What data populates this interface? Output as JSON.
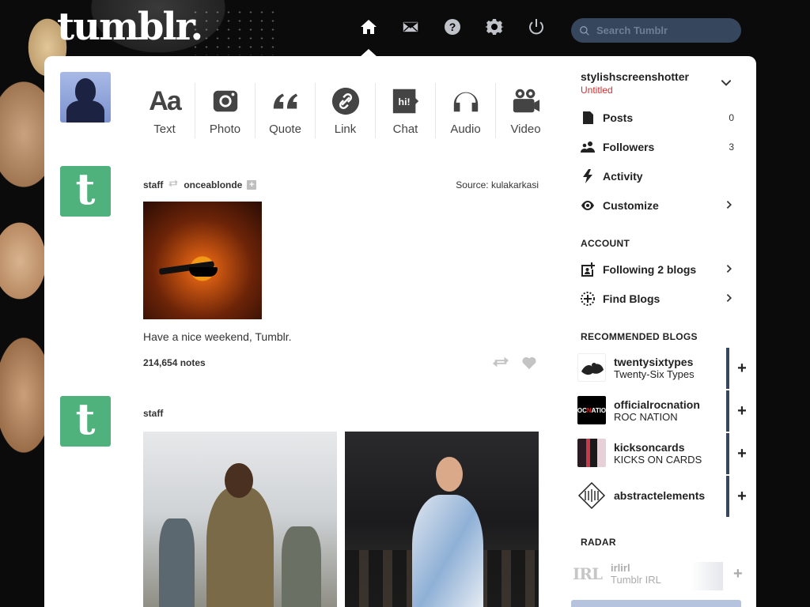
{
  "header": {
    "logo": "tumblr.",
    "search_placeholder": "Search Tumblr",
    "nav": [
      "home-icon",
      "mail-icon",
      "help-icon",
      "settings-icon",
      "power-icon"
    ]
  },
  "composer": {
    "types": [
      {
        "label": "Text",
        "icon": "text-icon",
        "glyph": "Aa"
      },
      {
        "label": "Photo",
        "icon": "camera-icon"
      },
      {
        "label": "Quote",
        "icon": "quote-icon"
      },
      {
        "label": "Link",
        "icon": "link-icon"
      },
      {
        "label": "Chat",
        "icon": "chat-icon",
        "glyph": "hi!"
      },
      {
        "label": "Audio",
        "icon": "headphones-icon"
      },
      {
        "label": "Video",
        "icon": "video-camera-icon"
      }
    ]
  },
  "posts": [
    {
      "author": "staff",
      "reblogged_from": "onceablonde",
      "source_label": "Source:",
      "source_value": "kulakarkasi",
      "caption": "Have a nice weekend, Tumblr.",
      "notes": "214,654 notes"
    },
    {
      "author": "staff"
    }
  ],
  "sidebar": {
    "blog_name": "stylishscreenshotter",
    "blog_subtitle": "Untitled",
    "items": [
      {
        "label": "Posts",
        "count": "0",
        "icon": "posts-icon"
      },
      {
        "label": "Followers",
        "count": "3",
        "icon": "followers-icon"
      },
      {
        "label": "Activity",
        "icon": "activity-icon"
      },
      {
        "label": "Customize",
        "icon": "eye-icon"
      }
    ],
    "account_title": "ACCOUNT",
    "account_items": [
      {
        "label": "Following 2 blogs",
        "icon": "following-icon"
      },
      {
        "label": "Find Blogs",
        "icon": "find-blogs-icon"
      }
    ],
    "recommended_title": "RECOMMENDED BLOGS",
    "recommended": [
      {
        "name": "twentysixtypes",
        "title": "Twenty-Six Types",
        "plus": "+"
      },
      {
        "name": "officialrocnation",
        "title": "ROC NATION",
        "plus": "+"
      },
      {
        "name": "kicksoncards",
        "title": "KICKS ON CARDS",
        "plus": "+"
      },
      {
        "name": "abstractelements",
        "title": "",
        "plus": "+"
      }
    ],
    "radar_title": "RADAR",
    "radar": {
      "logo": "IRL",
      "name": "irlirl",
      "title": "Tumblr IRL",
      "plus": "+"
    }
  },
  "colors": {
    "accent": "#36465d",
    "tumblr_green": "#4fb17c",
    "subtitle_red": "#d0302f"
  }
}
